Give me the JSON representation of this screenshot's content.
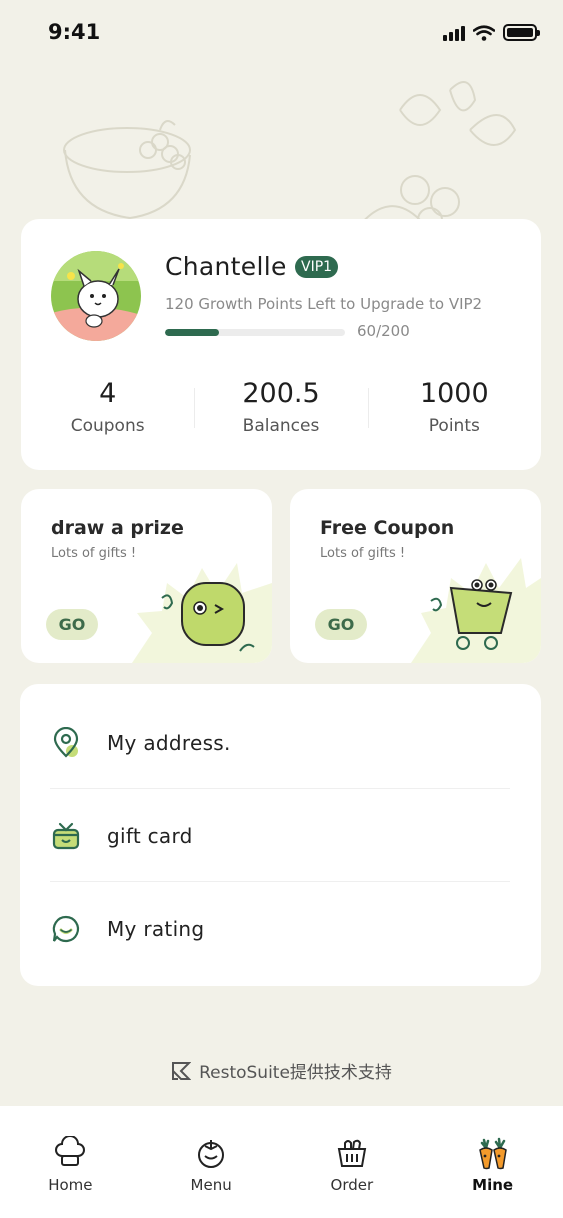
{
  "status_bar": {
    "time": "9:41"
  },
  "profile": {
    "name": "Chantelle",
    "vip_level": "VIP1",
    "growth_text": "120 Growth Points Left to Upgrade to VIP2",
    "progress_text": "60/200",
    "progress_fraction": 0.3
  },
  "stats": [
    {
      "value": "4",
      "label": "Coupons"
    },
    {
      "value": "200.5",
      "label": "Balances"
    },
    {
      "value": "1000",
      "label": "Points"
    }
  ],
  "promos": [
    {
      "title": "draw a prize",
      "subtitle": "Lots of gifts !",
      "button": "GO"
    },
    {
      "title": "Free Coupon",
      "subtitle": "Lots of gifts !",
      "button": "GO"
    }
  ],
  "menu": [
    {
      "label": "My address.",
      "icon": "location-pin-icon"
    },
    {
      "label": "gift card",
      "icon": "gift-card-icon"
    },
    {
      "label": "My rating",
      "icon": "chat-bubble-icon"
    }
  ],
  "footer": {
    "powered_by": "RestoSuite提供技术支持"
  },
  "tabs": [
    {
      "label": "Home",
      "icon": "chef-hat-icon"
    },
    {
      "label": "Menu",
      "icon": "tomato-icon"
    },
    {
      "label": "Order",
      "icon": "basket-icon"
    },
    {
      "label": "Mine",
      "icon": "carrot-icon",
      "active": true
    }
  ],
  "colors": {
    "background": "#f2f1e8",
    "accent_green": "#2e6a4f",
    "go_button_bg": "#e3ebc9"
  }
}
